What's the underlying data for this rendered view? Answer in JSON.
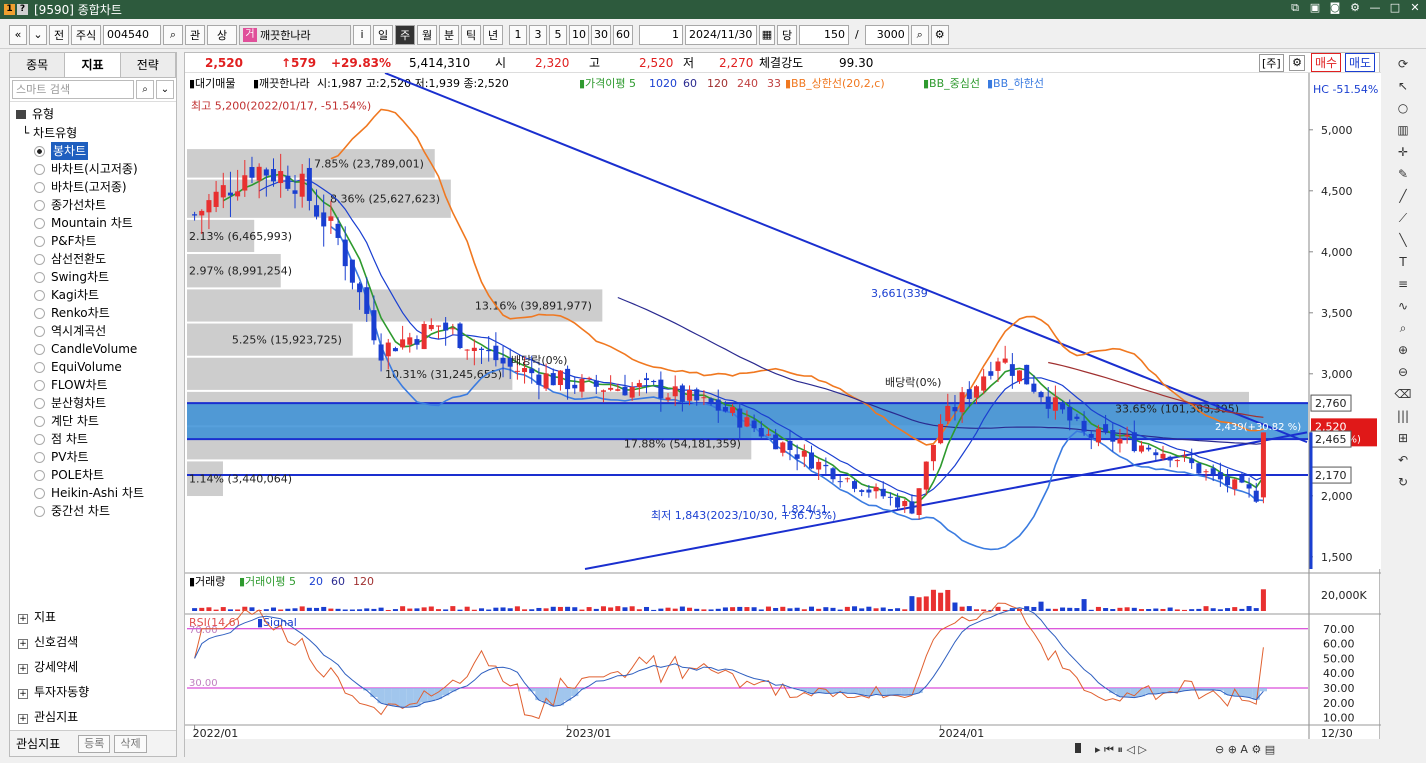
{
  "window": {
    "title": "[9590] 종합차트",
    "icon1": "1",
    "icon2": "?"
  },
  "toolbar": {
    "nav_prev": "«",
    "nav_menu": "⌄",
    "btn_jeon": "전",
    "market": "주식",
    "code": "004540",
    "search_icon": "⌕",
    "btn_gwan": "관",
    "btn_sang": "상",
    "stock_badge": "거",
    "stock_name": "깨끗한나라",
    "btn_info": "i",
    "periods": [
      "일",
      "주",
      "월",
      "분",
      "틱",
      "년"
    ],
    "active_period": "주",
    "intervals": [
      "1",
      "3",
      "5",
      "10",
      "30",
      "60"
    ],
    "count_value": "1",
    "date": "2024/11/30",
    "cal_icon": "▦",
    "btn_dang": "당",
    "bars_shown": "150",
    "slash": "/",
    "bars_total": "3000"
  },
  "left_panel": {
    "tabs": [
      "종목",
      "지표",
      "전략"
    ],
    "active_tab": "지표",
    "search_placeholder": "스마트 검색",
    "category": "유형",
    "subcategory": "차트유형",
    "chart_types": [
      "봉차트",
      "바차트(시고저종)",
      "바차트(고저종)",
      "종가선차트",
      "Mountain 차트",
      "P&F차트",
      "삼선전환도",
      "Swing차트",
      "Kagi차트",
      "Renko차트",
      "역시계곡선",
      "CandleVolume",
      "EquiVolume",
      "FLOW차트",
      "분산형차트",
      "계단 차트",
      "점 차트",
      "PV차트",
      "POLE차트",
      "Heikin-Ashi 차트",
      "중간선 차트"
    ],
    "selected_type": "봉차트",
    "lower_sections": [
      "지표",
      "신호검색",
      "강세약세",
      "투자자동향",
      "관심지표"
    ],
    "fav_label": "관심지표",
    "fav_register": "등록",
    "fav_delete": "삭제"
  },
  "quote": {
    "price": "2,520",
    "change": "↑579",
    "change_pct": "+29.83%",
    "volume": "5,414,310",
    "open_label": "시",
    "open": "2,320",
    "high_label": "고",
    "high": "2,520",
    "low_label": "저",
    "low": "2,270",
    "strength_label": "체결강도",
    "strength": "99.30",
    "unit_btn": "[주]",
    "buy_btn": "매수",
    "sell_btn": "매도"
  },
  "price_panel": {
    "legend": {
      "prefix": "▮대기매물",
      "stock": "▮깨끗한나라",
      "ohlc": "시:1,987 고:2,520 저:1,939 종:2,520",
      "ma_label": "▮가격이평 5",
      "ma10": "10",
      "ma20": "20",
      "ma60": "60",
      "ma120": "120",
      "ma240": "240",
      "ma33": "33",
      "bb_up": "▮BB_상한선(20,2,c)",
      "bb_mid": "▮BB_중심선",
      "bb_low": "▮BB_하한선"
    },
    "hc_label": "HC -51.54%",
    "high_note": "최고 5,200(2022/01/17, -51.54%)",
    "low_note": "최저 1,843(2023/10/30, +36.73%)",
    "low_note2": "1,824(-1.",
    "note_3661": "3,661(339",
    "note_div1": "배당락(0%)",
    "note_div2": "배당락(0%)",
    "note_3365": "33.65% (101,383,395)",
    "note_2439": "2,439(+30.82 %)",
    "volume_profile": [
      {
        "pct": "7.85% (23,789,001)",
        "lo": 4600,
        "hi": 4850
      },
      {
        "pct": "8.36% (25,627,623)",
        "lo": 4270,
        "hi": 4600
      },
      {
        "pct": "2.13% (6,465,993)",
        "lo": 3990,
        "hi": 4270
      },
      {
        "pct": "2.97% (8,991,254)",
        "lo": 3700,
        "hi": 3990
      },
      {
        "pct": "13.16% (39,891,977)",
        "lo": 3420,
        "hi": 3700
      },
      {
        "pct": "5.25% (15,923,725)",
        "lo": 3140,
        "hi": 3420
      },
      {
        "pct": "10.31% (31,245,655)",
        "lo": 2860,
        "hi": 3140
      },
      {
        "pct": "33.65% (101,383,395)",
        "lo": 2570,
        "hi": 2860
      },
      {
        "pct": "17.88% (54,181,359)",
        "lo": 2290,
        "hi": 2570
      },
      {
        "pct": "1.14% (3,440,064)",
        "lo": 1990,
        "hi": 2290
      }
    ],
    "levels": {
      "l1": "2,760",
      "l2": "2,465",
      "l3": "2,170",
      "cur": "2,520",
      "cur_pct": "(29.83%)"
    },
    "y_ticks": [
      "5,000",
      "4,500",
      "4,000",
      "3,500",
      "3,000",
      "2,500",
      "2,000",
      "1,500"
    ],
    "colors": {
      "up": "#e83030",
      "down": "#1a3fd1",
      "ma5": "#2e9a2e",
      "ma20": "#1a3fd1",
      "bb_up": "#f07820",
      "bb_low": "#3a7be0",
      "ma120": "#a03030",
      "ma60": "#2a2a90",
      "zone": "#3a8fd6",
      "trend": "#1a2fcf"
    }
  },
  "volume_panel": {
    "legend_title": "▮거래량",
    "legend_ma": "▮거래이평 5",
    "legend_ma20": "20",
    "legend_ma60": "60",
    "legend_ma120": "120",
    "y_tick": "20,000K"
  },
  "rsi_panel": {
    "legend": "RSI(14,6)",
    "signal": "▮Signal",
    "upper": "70.00",
    "lower": "30.00",
    "y_ticks": [
      "70.00",
      "60.00",
      "50.00",
      "40.00",
      "30.00",
      "20.00",
      "10.00"
    ]
  },
  "x_axis": {
    "labels": [
      "2022/01",
      "2023/01",
      "2024/01"
    ],
    "end": "12/30"
  },
  "chart_data": {
    "type": "candlestick",
    "x_labels": [
      "2022/01",
      "2023/01",
      "2024/01"
    ],
    "price_range": [
      1400,
      5400
    ],
    "rsi_range": [
      5,
      80
    ],
    "last_close": 2520
  }
}
